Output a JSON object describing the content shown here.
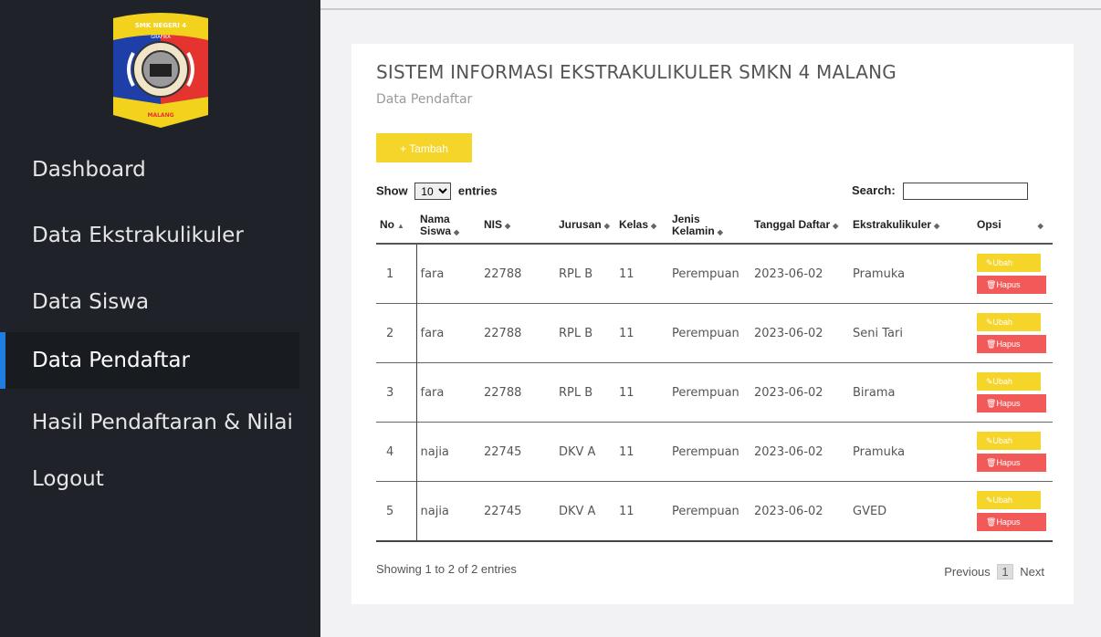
{
  "sidebar": {
    "logo_text": [
      "SMK NEGERI 4",
      "GRAFIKA",
      "MALANG"
    ],
    "items": [
      {
        "label": "Dashboard",
        "active": false
      },
      {
        "label": "Data Ekstrakulikuler",
        "active": false
      },
      {
        "label": "Data Siswa",
        "active": false
      },
      {
        "label": "Data Pendaftar",
        "active": true
      },
      {
        "label": "Hasil Pendaftaran & Nilai",
        "active": false
      },
      {
        "label": "Logout",
        "active": false
      }
    ]
  },
  "main": {
    "title": "SISTEM INFORMASI EKSTRAKULIKULER SMKN 4 MALANG",
    "subtitle": "Data Pendaftar",
    "add_button": "+ Tambah",
    "show_label": "Show",
    "entries_value": "10",
    "entries_label": "entries",
    "search_label": "Search:",
    "search_value": ""
  },
  "table": {
    "headers": [
      "No",
      "Nama Siswa",
      "NIS",
      "Jurusan",
      "Kelas",
      "Jenis Kelamin",
      "Tanggal Daftar",
      "Ekstrakulikuler",
      "Opsi"
    ],
    "rows": [
      {
        "no": "1",
        "nama": "fara",
        "nis": "22788",
        "jurusan": "RPL B",
        "kelas": "11",
        "jk": "Perempuan",
        "tanggal": "2023-06-02",
        "ekstra": "Pramuka"
      },
      {
        "no": "2",
        "nama": "fara",
        "nis": "22788",
        "jurusan": "RPL B",
        "kelas": "11",
        "jk": "Perempuan",
        "tanggal": "2023-06-02",
        "ekstra": "Seni Tari"
      },
      {
        "no": "3",
        "nama": "fara",
        "nis": "22788",
        "jurusan": "RPL B",
        "kelas": "11",
        "jk": "Perempuan",
        "tanggal": "2023-06-02",
        "ekstra": "Birama"
      },
      {
        "no": "4",
        "nama": "najia",
        "nis": "22745",
        "jurusan": "DKV A",
        "kelas": "11",
        "jk": "Perempuan",
        "tanggal": "2023-06-02",
        "ekstra": "Pramuka"
      },
      {
        "no": "5",
        "nama": "najia",
        "nis": "22745",
        "jurusan": "DKV A",
        "kelas": "11",
        "jk": "Perempuan",
        "tanggal": "2023-06-02",
        "ekstra": "GVED"
      }
    ],
    "edit_label": "Ubah",
    "delete_label": "Hapus"
  },
  "footer": {
    "info": "Showing 1 to 2 of 2 entries",
    "previous": "Previous",
    "page": "1",
    "next": "Next"
  },
  "colors": {
    "sidebar_bg": "#1f2329",
    "accent": "#1f7de1",
    "yellow": "#f5d529",
    "red": "#f25a5a"
  }
}
